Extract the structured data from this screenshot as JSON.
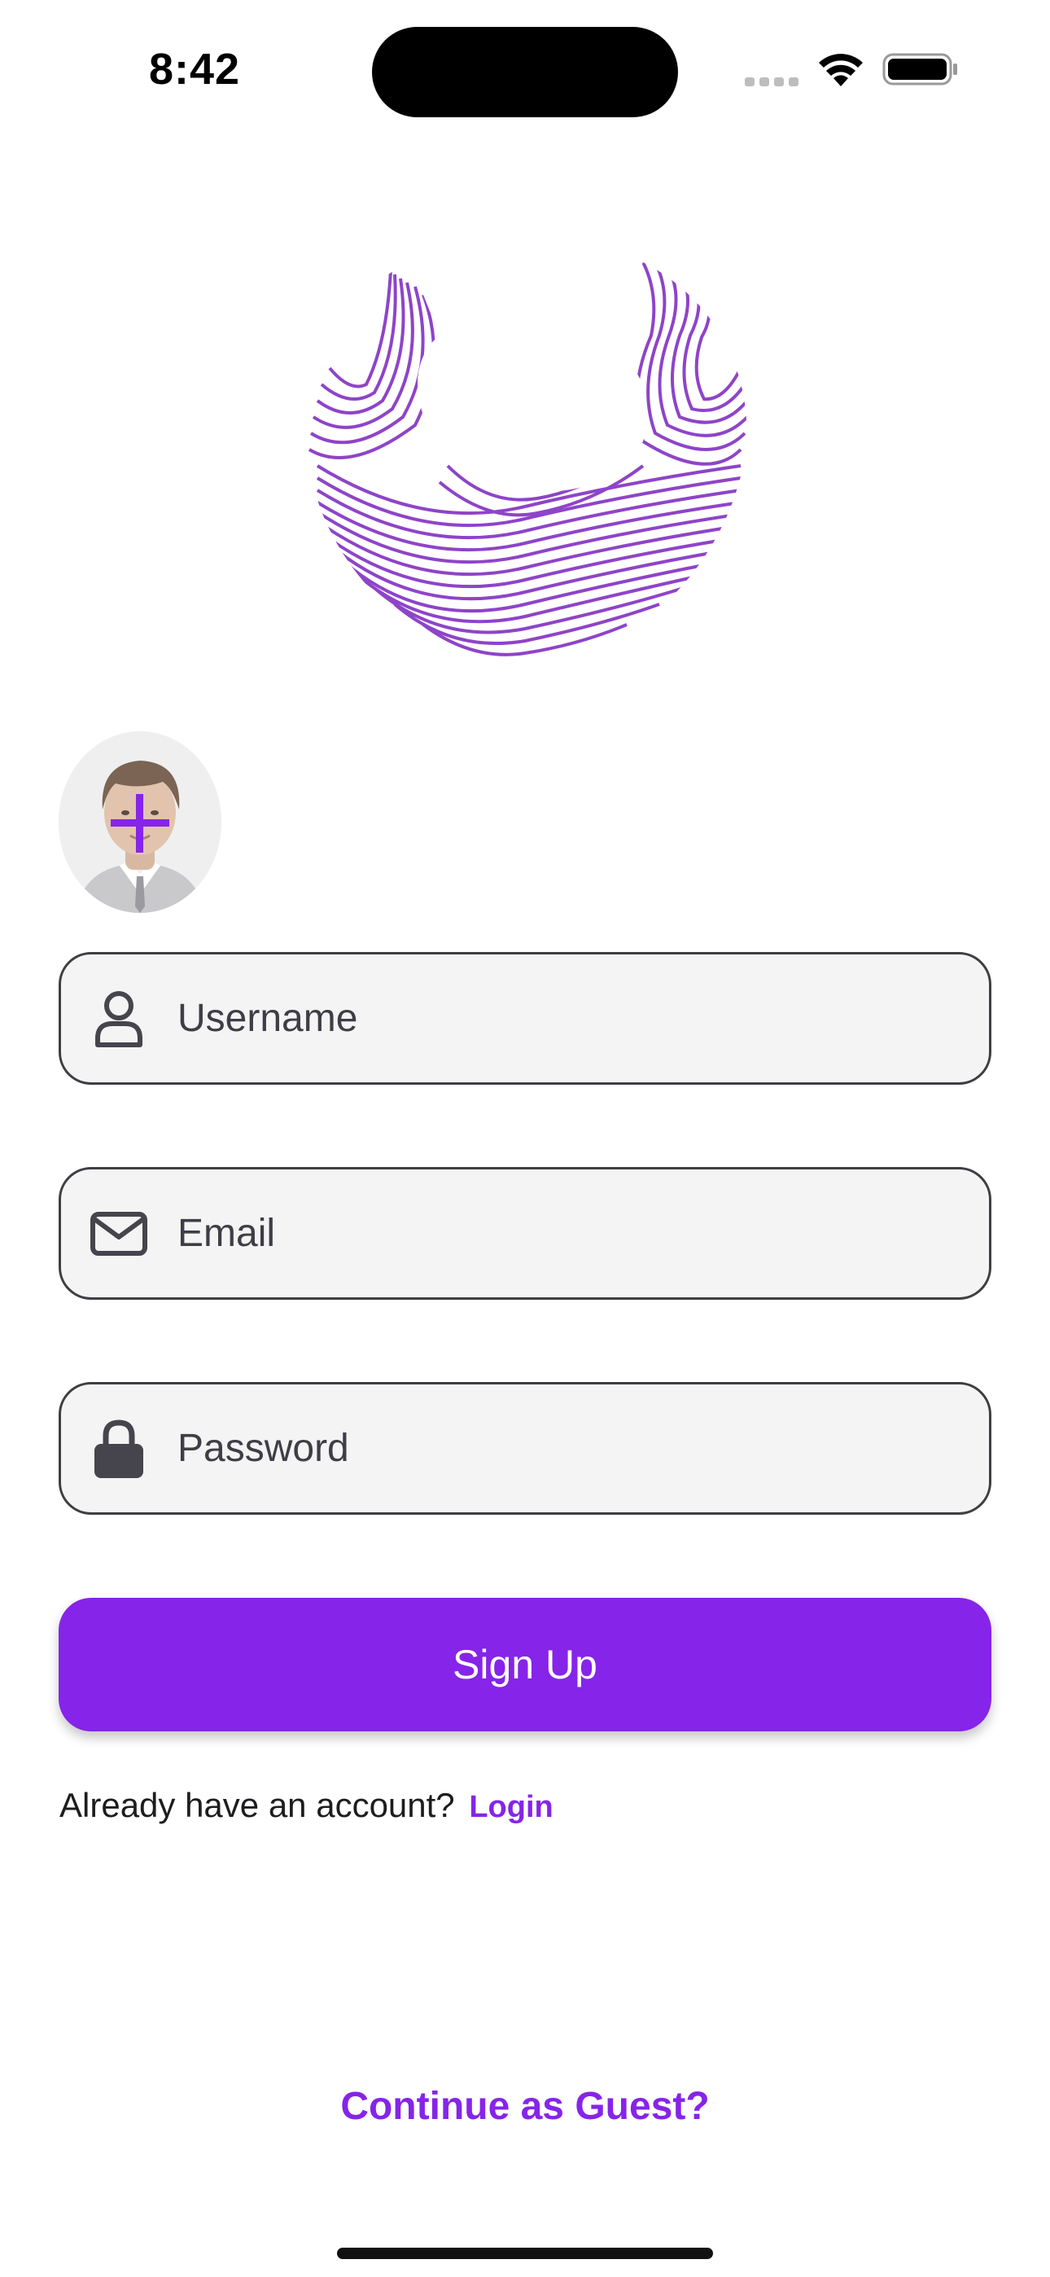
{
  "status_bar": {
    "time": "8:42"
  },
  "logo": {
    "icon": "swirl-sphere-logo",
    "color": "#8e44c8"
  },
  "avatar": {
    "icon": "profile-photo-placeholder",
    "add_icon": "plus-icon"
  },
  "form": {
    "username": {
      "placeholder": "Username",
      "value": "",
      "icon": "person-icon"
    },
    "email": {
      "placeholder": "Email",
      "value": "",
      "icon": "envelope-icon"
    },
    "password": {
      "placeholder": "Password",
      "value": "",
      "icon": "lock-icon"
    },
    "submit_label": "Sign Up"
  },
  "login_prompt": {
    "text": "Already have an account?",
    "link_label": "Login"
  },
  "guest_label": "Continue as Guest?",
  "colors": {
    "accent": "#8624e9",
    "field_background": "#f4f4f4",
    "field_border": "#3e3e43"
  }
}
